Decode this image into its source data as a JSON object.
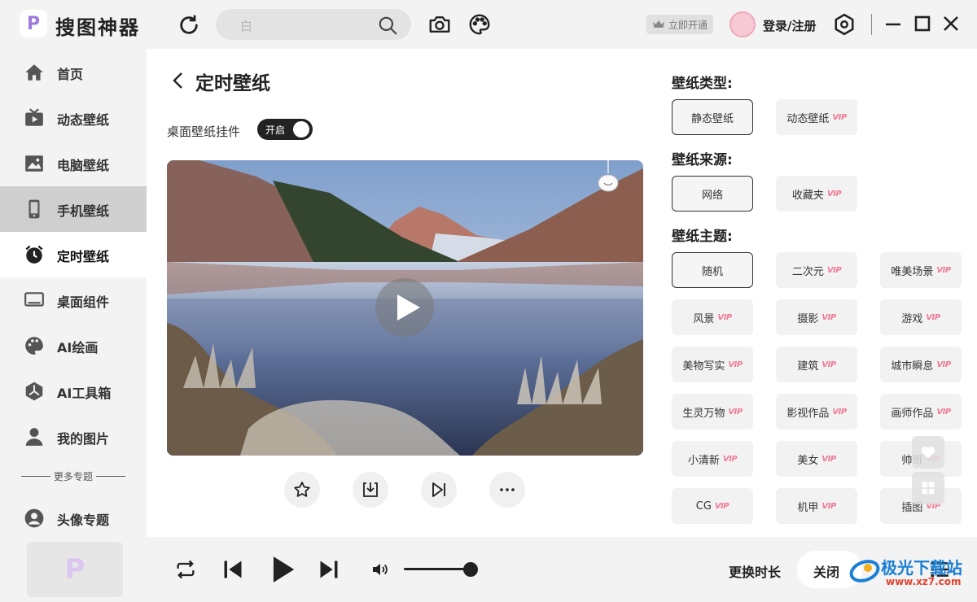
{
  "app": {
    "logo_letter": "P",
    "title": "搜图神器"
  },
  "search": {
    "placeholder": "白"
  },
  "header": {
    "vip_label": "立即开通",
    "login_label": "登录/注册"
  },
  "sidebar": {
    "items": [
      {
        "label": "首页",
        "icon": "home-icon"
      },
      {
        "label": "动态壁纸",
        "icon": "tv-icon"
      },
      {
        "label": "电脑壁纸",
        "icon": "image-icon"
      },
      {
        "label": "手机壁纸",
        "icon": "phone-icon"
      },
      {
        "label": "定时壁纸",
        "icon": "alarm-clock-icon"
      },
      {
        "label": "桌面组件",
        "icon": "monitor-icon"
      },
      {
        "label": "AI绘画",
        "icon": "palette-icon"
      },
      {
        "label": "AI工具箱",
        "icon": "toolbox-icon"
      },
      {
        "label": "我的图片",
        "icon": "user-icon"
      }
    ],
    "more_label": "更多专题",
    "extra_item": {
      "label": "头像专题",
      "icon": "avatar-icon"
    }
  },
  "page": {
    "title": "定时壁纸",
    "widget_label": "桌面壁纸挂件",
    "toggle_label": "开启"
  },
  "options": {
    "type_title": "壁纸类型:",
    "types": [
      {
        "label": "静态壁纸",
        "vip": false,
        "selected": true
      },
      {
        "label": "动态壁纸",
        "vip": true,
        "selected": false
      }
    ],
    "source_title": "壁纸来源:",
    "sources": [
      {
        "label": "网络",
        "vip": false,
        "selected": true
      },
      {
        "label": "收藏夹",
        "vip": true,
        "selected": false
      }
    ],
    "theme_title": "壁纸主题:",
    "themes": [
      {
        "label": "随机",
        "vip": false,
        "selected": true
      },
      {
        "label": "二次元",
        "vip": true
      },
      {
        "label": "唯美场景",
        "vip": true
      },
      {
        "label": "风景",
        "vip": true
      },
      {
        "label": "摄影",
        "vip": true
      },
      {
        "label": "游戏",
        "vip": true
      },
      {
        "label": "美物写实",
        "vip": true
      },
      {
        "label": "建筑",
        "vip": true
      },
      {
        "label": "城市瞬息",
        "vip": true
      },
      {
        "label": "生灵万物",
        "vip": true
      },
      {
        "label": "影视作品",
        "vip": true
      },
      {
        "label": "画师作品",
        "vip": true
      },
      {
        "label": "小清新",
        "vip": true
      },
      {
        "label": "美女",
        "vip": true
      },
      {
        "label": "帅哥",
        "vip": true
      },
      {
        "label": "CG",
        "vip": true
      },
      {
        "label": "机甲",
        "vip": true
      },
      {
        "label": "插图",
        "vip": true
      }
    ],
    "vip_tag": "VIP"
  },
  "player": {
    "volume": 0.88,
    "change_label": "更换时长",
    "close_label": "关闭"
  },
  "watermark": {
    "name": "极光下载站",
    "url": "www.xz7.com"
  }
}
